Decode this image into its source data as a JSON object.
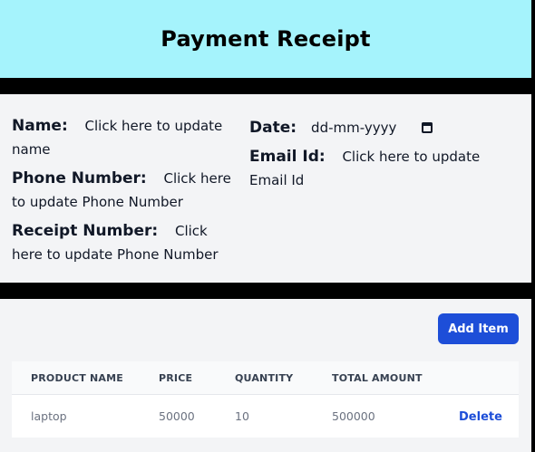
{
  "header": {
    "title": "Payment Receipt"
  },
  "form": {
    "name": {
      "label": "Name:",
      "value": "Click here to update name"
    },
    "phone": {
      "label": "Phone Number:",
      "value": "Click here to update Phone Number"
    },
    "receipt": {
      "label": "Receipt Number:",
      "value": "Click here to update Phone Number"
    },
    "date": {
      "label": "Date:",
      "placeholder": "dd-mm-yyyy",
      "icon": "calendar-icon"
    },
    "email": {
      "label": "Email Id:",
      "value": "Click here to update Email Id"
    }
  },
  "items": {
    "add_button_label": "Add Item",
    "columns": [
      "PRODUCT NAME",
      "PRICE",
      "QUANTITY",
      "TOTAL AMOUNT"
    ],
    "rows": [
      {
        "product": "laptop",
        "price": "50000",
        "quantity": "10",
        "total": "500000",
        "action": "Delete"
      }
    ]
  },
  "colors": {
    "header_bg": "#a5f3fc",
    "panel_bg": "#f3f4f6",
    "accent": "#1d4ed8"
  }
}
